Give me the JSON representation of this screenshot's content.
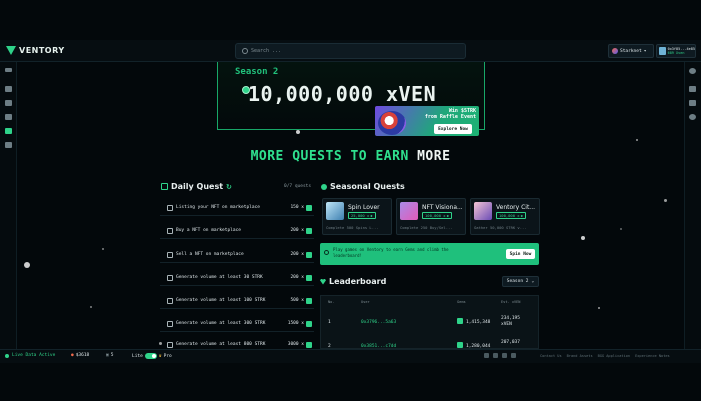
{
  "app": {
    "brand": "VENTORY"
  },
  "topbar": {
    "search_placeholder": "Search ...",
    "network": "Starknet",
    "wallet_address": "0x3f85...4e85",
    "wallet_balance": "689 Xven"
  },
  "banner": {
    "season": "Season 2",
    "amount": "10,000,000 xVEN",
    "promo_line1": "Win $STRK",
    "promo_line2": "from Raffle Event",
    "promo_button": "Explore Now"
  },
  "heading": {
    "part1": "MORE QUESTS TO EARN ",
    "part2": "MORE"
  },
  "daily_quest": {
    "title": "Daily Quest",
    "count": "0/7 quests",
    "items": [
      {
        "name": "Listing your NFT on marketplace",
        "reward": "150 x"
      },
      {
        "name": "Buy a NFT on marketplace",
        "reward": "200 x"
      },
      {
        "name": "Sell a NFT on marketplace",
        "reward": "200 x"
      },
      {
        "name": "Generate volume at least 30 STRK",
        "reward": "200 x"
      },
      {
        "name": "Generate volume at least 100 STRK",
        "reward": "500 x"
      },
      {
        "name": "Generate volume at least 300 STRK",
        "reward": "1500 x"
      },
      {
        "name": "Generate volume at least 800 STRK",
        "reward": "3000 x"
      }
    ]
  },
  "seasonal_quests": {
    "title": "Seasonal Quests",
    "cards": [
      {
        "name": "Spin Lover",
        "badge": "25,000 x",
        "desc": "Complete 500 Spins L..."
      },
      {
        "name": "NFT Visiona...",
        "badge": "100,000 x",
        "desc": "Complete 250 Buy/Sel..."
      },
      {
        "name": "Ventory Cit...",
        "badge": "100,000 x",
        "desc": "Gather 50,000 STRK v..."
      }
    ]
  },
  "spin": {
    "text": "Play games on Ventory to earn Gems and climb the leaderboard!",
    "button": "Spin Now"
  },
  "leaderboard": {
    "title": "Leaderboard",
    "season_select": "Season 2",
    "headers": {
      "no": "No.",
      "user": "User",
      "gems": "Gems",
      "est": "Est. xVEN"
    },
    "rows": [
      {
        "no": "1",
        "user": "0x3796...5a63",
        "gems": "1,415,348",
        "est": "234,195",
        "est_unit": "xVEN"
      },
      {
        "no": "2",
        "user": "0x3851...c7dd",
        "gems": "1,280,044",
        "est": "207,037",
        "est_unit": "xVEN"
      }
    ]
  },
  "bottombar": {
    "live": "Live Data Active",
    "price": "$3618",
    "count": "5",
    "lite": "Lite",
    "pro": "Pro",
    "links": [
      "Contact Us",
      "Brand Assets",
      "BGG Application",
      "Experience Notes"
    ]
  },
  "colors": {
    "accent": "#2fd38a",
    "background": "#03080b"
  }
}
